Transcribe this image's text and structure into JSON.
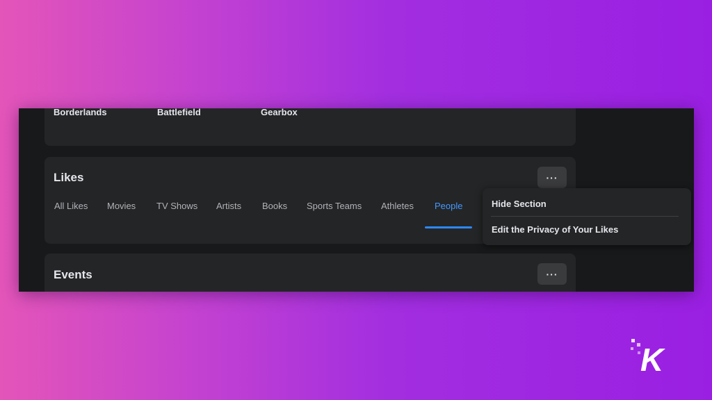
{
  "top_card": {
    "items": [
      "Borderlands",
      "Battlefield",
      "Gearbox"
    ]
  },
  "likes": {
    "title": "Likes",
    "more_label": "···",
    "tabs": [
      "All Likes",
      "Movies",
      "TV Shows",
      "Artists",
      "Books",
      "Sports Teams",
      "Athletes",
      "People"
    ],
    "active_tab": "People"
  },
  "menu": {
    "hide_section": "Hide Section",
    "edit_privacy": "Edit the Privacy of Your Likes"
  },
  "events": {
    "title": "Events",
    "more_label": "···"
  },
  "logo": {
    "text": "K"
  },
  "colors": {
    "accent": "#2d88ff",
    "card_bg": "#242526",
    "page_bg": "#18191a"
  }
}
